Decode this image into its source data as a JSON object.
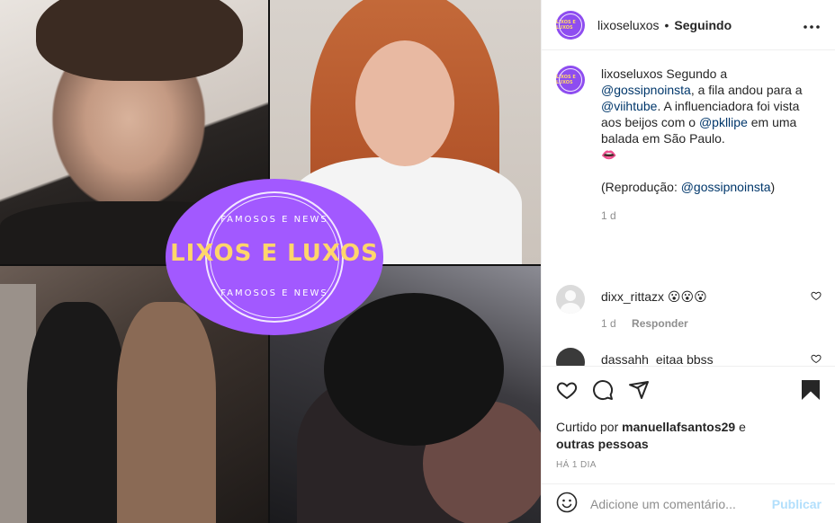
{
  "logo": {
    "main": "LIXOS E LUXOS",
    "top_ring": "FAMOSOS E NEWS",
    "bottom_ring": "FAMOSOS E NEWS",
    "colors": {
      "badge": "#a259ff",
      "text": "#ffd66b"
    }
  },
  "header": {
    "username": "lixoseluxos",
    "separator": "•",
    "follow_status": "Seguindo",
    "more_icon": "more-options-icon"
  },
  "caption": {
    "username": "lixoseluxos",
    "text_1": "Segundo a",
    "mention_1": "@gossipnoinsta",
    "text_2": ",",
    "text_3": "a fila andou para a",
    "mention_2": "@viihtube",
    "text_4": ". A influenciadora foi vista aos beijos com o",
    "mention_3": "@pkllipe",
    "text_5": "em uma balada em São Paulo.",
    "emoji": "👄",
    "repro_prefix": "(Reprodução:",
    "repro_mention": "@gossipnoinsta",
    "repro_suffix": ")",
    "age": "1 d"
  },
  "comments": [
    {
      "username": "dixx_rittazx",
      "text": "😮😮😮",
      "age": "1 d",
      "reply": "Responder"
    },
    {
      "username": "dassahh",
      "text": "eitaa bbss"
    }
  ],
  "actions": {
    "like_icon": "heart-icon",
    "comment_icon": "comment-icon",
    "share_icon": "share-icon",
    "save_icon": "bookmark-icon"
  },
  "likes": {
    "prefix": "Curtido por",
    "user": "manuellafsantos29",
    "connector": "e",
    "others": "outras pessoas"
  },
  "time_ago": "HÁ 1 DIA",
  "add_comment": {
    "placeholder": "Adicione um comentário...",
    "publish": "Publicar"
  }
}
